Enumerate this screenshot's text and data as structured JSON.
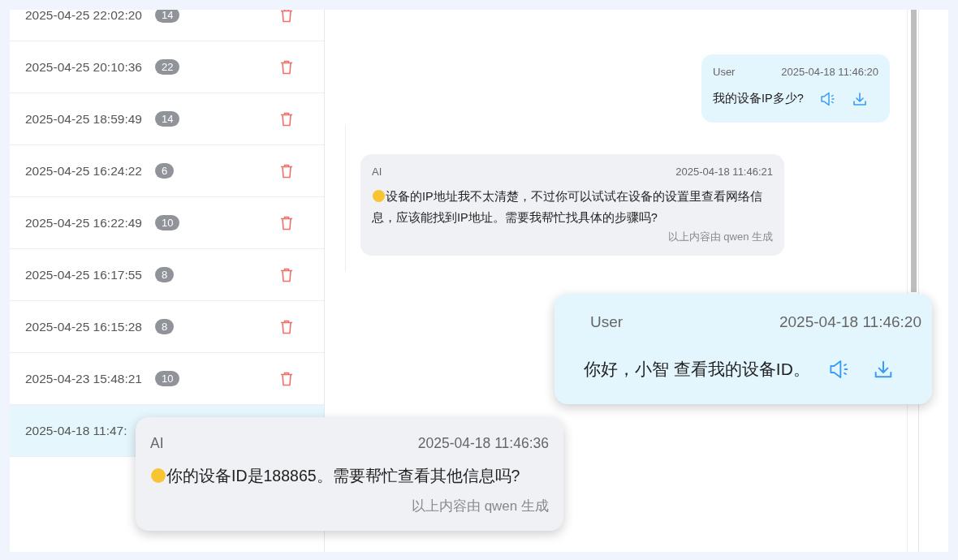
{
  "sessions": [
    {
      "time": "2025-04-25 22:02:20",
      "count": "14",
      "selected": false
    },
    {
      "time": "2025-04-25 20:10:36",
      "count": "22",
      "selected": false
    },
    {
      "time": "2025-04-25 18:59:49",
      "count": "14",
      "selected": false
    },
    {
      "time": "2025-04-25 16:24:22",
      "count": "6",
      "selected": false
    },
    {
      "time": "2025-04-25 16:22:49",
      "count": "10",
      "selected": false
    },
    {
      "time": "2025-04-25 16:17:55",
      "count": "8",
      "selected": false
    },
    {
      "time": "2025-04-25 16:15:28",
      "count": "8",
      "selected": false
    },
    {
      "time": "2025-04-23 15:48:21",
      "count": "10",
      "selected": false
    },
    {
      "time": "2025-04-18 11:47:",
      "selected": true
    }
  ],
  "messages": [
    {
      "kind": "user",
      "sender": "User",
      "time": "2025-04-18 11:46:20",
      "text": "我的设备IP多少?"
    },
    {
      "kind": "ai",
      "sender": "AI",
      "time": "2025-04-18 11:46:21",
      "emoji": true,
      "text": "设备的IP地址我不太清楚，不过你可以试试在设备的设置里查看网络信息，应该能找到IP地址。需要我帮忙找具体的步骤吗?",
      "footer": "以上内容由 qwen 生成"
    }
  ],
  "callouts": [
    {
      "kind": "user",
      "sender": "User",
      "time": "2025-04-18 11:46:20",
      "text": "你好，小智 查看我的设备ID。"
    },
    {
      "kind": "ai",
      "sender": "AI",
      "time": "2025-04-18 11:46:36",
      "emoji": true,
      "text": "你的设备ID是188865。需要帮忙查看其他信息吗?",
      "footer": "以上内容由 qwen 生成"
    }
  ]
}
